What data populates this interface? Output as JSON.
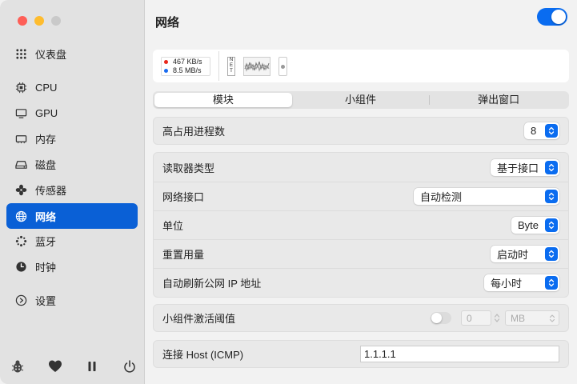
{
  "sidebar": {
    "items": [
      {
        "label": "仪表盘",
        "icon": "grid-dots-icon"
      },
      {
        "label": "CPU",
        "icon": "cpu-icon"
      },
      {
        "label": "GPU",
        "icon": "gpu-icon"
      },
      {
        "label": "内存",
        "icon": "memory-icon"
      },
      {
        "label": "磁盘",
        "icon": "disk-icon"
      },
      {
        "label": "传感器",
        "icon": "fan-icon"
      },
      {
        "label": "网络",
        "icon": "globe-icon",
        "active": true
      },
      {
        "label": "蓝牙",
        "icon": "bluetooth-icon"
      },
      {
        "label": "时钟",
        "icon": "clock-icon"
      },
      {
        "label": "设置",
        "icon": "settings-icon"
      }
    ],
    "bottom_icons": [
      "bug-icon",
      "heart-icon",
      "pause-icon",
      "power-icon"
    ]
  },
  "header": {
    "title": "网络",
    "module_enabled": true
  },
  "preview": {
    "upload": "467 KB/s",
    "download": "8.5 MB/s",
    "net_label": "NET",
    "upload_color": "#e8261b",
    "download_color": "#1a6cf0"
  },
  "tabs": [
    {
      "label": "模块",
      "active": true
    },
    {
      "label": "小组件"
    },
    {
      "label": "弹出窗口"
    }
  ],
  "settings": {
    "top_processes": {
      "label": "高占用进程数",
      "value": "8"
    },
    "reader_type": {
      "label": "读取器类型",
      "value": "基于接口"
    },
    "interface": {
      "label": "网络接口",
      "value": "自动检测"
    },
    "unit": {
      "label": "单位",
      "value": "Byte"
    },
    "reset_usage": {
      "label": "重置用量",
      "value": "启动时"
    },
    "refresh_ip": {
      "label": "自动刷新公网 IP 地址",
      "value": "每小时"
    },
    "widget_threshold": {
      "label": "小组件激活阈值",
      "value": "0",
      "unit": "MB"
    },
    "host": {
      "label": "连接 Host (ICMP)",
      "value": "1.1.1.1"
    }
  },
  "accent_color": "#0a60d6"
}
